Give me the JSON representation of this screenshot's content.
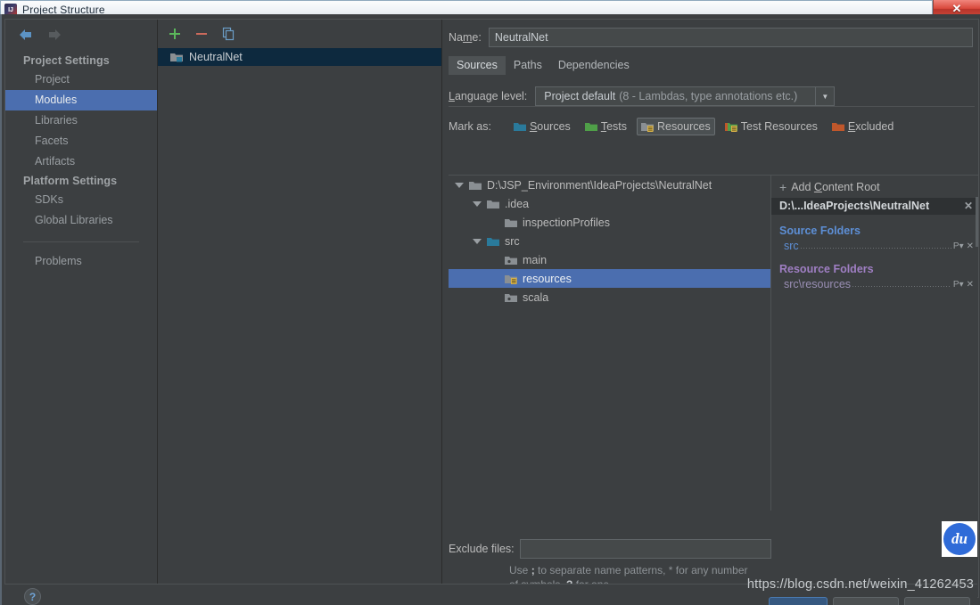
{
  "window": {
    "title": "Project Structure",
    "app_icon": "intellij-idea-icon",
    "close_label": "✕"
  },
  "nav": {
    "back_icon": "arrow-left-icon",
    "forward_icon": "arrow-right-icon"
  },
  "sidebar": {
    "groups": [
      {
        "label": "Project Settings",
        "items": [
          {
            "label": "Project",
            "selected": false
          },
          {
            "label": "Modules",
            "selected": true
          },
          {
            "label": "Libraries",
            "selected": false
          },
          {
            "label": "Facets",
            "selected": false
          },
          {
            "label": "Artifacts",
            "selected": false
          }
        ]
      },
      {
        "label": "Platform Settings",
        "items": [
          {
            "label": "SDKs",
            "selected": false
          },
          {
            "label": "Global Libraries",
            "selected": false
          }
        ]
      }
    ],
    "extra": {
      "label": "Problems"
    }
  },
  "modules": {
    "toolbar": {
      "add_label": "+",
      "remove_label": "−",
      "copy_label": "copy-icon"
    },
    "items": [
      {
        "label": "NeutralNet",
        "selected": true,
        "icon": "module-folder-icon"
      }
    ]
  },
  "main": {
    "name": {
      "label": "Name:",
      "label_pre": "Na",
      "label_accel": "m",
      "label_post": "e:",
      "value": "NeutralNet",
      "placeholder": ""
    },
    "tabs": [
      {
        "label": "Sources",
        "active": true
      },
      {
        "label": "Paths",
        "active": false
      },
      {
        "label": "Dependencies",
        "active": false
      }
    ],
    "language_level": {
      "label": "Language level:",
      "label_accel": "L",
      "label_rest": "anguage level:",
      "value_strong": "Project default",
      "value_dim": "(8 - Lambdas, type annotations etc.)",
      "arrow_icon": "chevron-down-icon"
    },
    "mark_as": {
      "label": "Mark as:",
      "options": [
        {
          "label": "Sources",
          "accel": "S",
          "rest": "ources",
          "color": "#2a7a9b",
          "active": false,
          "icon": "folder-sources-icon"
        },
        {
          "label": "Tests",
          "accel": "T",
          "rest": "ests",
          "color": "#4f9f48",
          "active": false,
          "icon": "folder-tests-icon"
        },
        {
          "label": "Resources",
          "accel": "",
          "rest": "Resources",
          "color": "#8a8f93",
          "active": true,
          "icon": "folder-resources-icon"
        },
        {
          "label": "Test Resources",
          "accel": "",
          "rest": "Test Resources",
          "color": "#4f9f48",
          "active": false,
          "icon": "folder-test-resources-icon"
        },
        {
          "label": "Excluded",
          "accel": "E",
          "rest": "xcluded",
          "color": "#c0572b",
          "active": false,
          "icon": "folder-excluded-icon"
        }
      ]
    },
    "tree": [
      {
        "label": "D:\\JSP_Environment\\IdeaProjects\\NeutralNet",
        "depth": 0,
        "twisty": "open",
        "icon": "folder-icon",
        "color": "#8a8f93",
        "selected": false
      },
      {
        "label": ".idea",
        "depth": 1,
        "twisty": "open",
        "icon": "folder-icon",
        "color": "#8a8f93",
        "selected": false
      },
      {
        "label": "inspectionProfiles",
        "depth": 2,
        "twisty": "none",
        "icon": "folder-icon",
        "color": "#8a8f93",
        "selected": false
      },
      {
        "label": "src",
        "depth": 1,
        "twisty": "open",
        "icon": "folder-sources-icon",
        "color": "#2a7a9b",
        "selected": false
      },
      {
        "label": "main",
        "depth": 2,
        "twisty": "none",
        "icon": "folder-dot-icon",
        "color": "#8a8f93",
        "selected": false
      },
      {
        "label": "resources",
        "depth": 2,
        "twisty": "none",
        "icon": "folder-resources-icon",
        "color": "#8a8f93",
        "selected": true
      },
      {
        "label": "scala",
        "depth": 2,
        "twisty": "none",
        "icon": "folder-dot-icon",
        "color": "#8a8f93",
        "selected": false
      }
    ],
    "content_roots": {
      "add_label": "Add Content Root",
      "add_pre": "Add ",
      "add_accel": "C",
      "add_post": "ontent Root",
      "root_path": "D:\\...IdeaProjects\\NeutralNet",
      "remove_icon": "close-icon",
      "groups": [
        {
          "title": "Source Folders",
          "kind": "src",
          "folders": [
            {
              "path": "src",
              "properties_icon": "properties-icon",
              "remove_icon": "close-icon"
            }
          ]
        },
        {
          "title": "Resource Folders",
          "kind": "res",
          "folders": [
            {
              "path": "src\\resources",
              "properties_icon": "properties-icon",
              "remove_icon": "close-icon"
            }
          ]
        }
      ]
    },
    "exclude": {
      "label": "Exclude files:",
      "value": "",
      "placeholder": "",
      "hint_1_a": "Use ",
      "hint_1_b": ";",
      "hint_1_c": " to separate name patterns, * for any",
      "hint_2_a": "number of symbols, ",
      "hint_2_b": "?",
      "hint_2_c": " for one."
    }
  },
  "footer": {
    "help_icon": "help-icon",
    "watermark": "https://blog.csdn.net/weixin_41262453",
    "badge_text": "du"
  }
}
